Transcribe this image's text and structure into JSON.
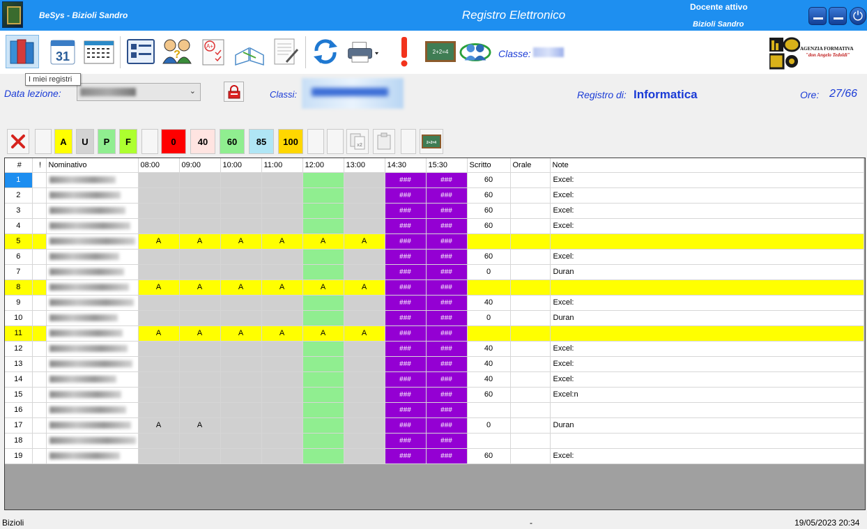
{
  "app": {
    "name": "BeSys - Bizioli Sandro",
    "title": "Registro Elettronico",
    "docente_label": "Docente attivo",
    "docente_name": "Bizioli Sandro"
  },
  "toolbar": {
    "classe_label": "Classe:",
    "tooltip": "I miei registri",
    "agency_line1": "AGENZIA FORMATIVA",
    "agency_line2": "\"don Angelo Tedoldi\""
  },
  "info": {
    "data_lezione_label": "Data lezione:",
    "classi_label": "Classi:",
    "registro_label": "Registro di:",
    "registro_value": "Informatica",
    "ore_label": "Ore:",
    "ore_value": "27/66"
  },
  "quick": {
    "a": "A",
    "u": "U",
    "p": "P",
    "f": "F",
    "v0": "0",
    "v40": "40",
    "v60": "60",
    "v85": "85",
    "v100": "100"
  },
  "colors": {
    "title_bar": "#1e8ff0",
    "label_blue": "#1a3bd6",
    "absent_row": "#ffff00",
    "purple_cell": "#9400d3",
    "green_cell": "#90ee90"
  },
  "grid": {
    "columns": [
      "#",
      "!",
      "Nominativo",
      "08:00",
      "09:00",
      "10:00",
      "11:00",
      "12:00",
      "13:00",
      "14:30",
      "15:30",
      "Scritto",
      "Orale",
      "Note"
    ],
    "rows": [
      {
        "n": "1",
        "absent": false,
        "h": [
          "",
          "",
          "",
          "",
          "",
          "",
          "###",
          "###"
        ],
        "scritto": "60",
        "note": "Excel:"
      },
      {
        "n": "2",
        "absent": false,
        "h": [
          "",
          "",
          "",
          "",
          "",
          "",
          "###",
          "###"
        ],
        "scritto": "60",
        "note": "Excel:"
      },
      {
        "n": "3",
        "absent": false,
        "h": [
          "",
          "",
          "",
          "",
          "",
          "",
          "###",
          "###"
        ],
        "scritto": "60",
        "note": "Excel:"
      },
      {
        "n": "4",
        "absent": false,
        "h": [
          "",
          "",
          "",
          "",
          "",
          "",
          "###",
          "###"
        ],
        "scritto": "60",
        "note": "Excel:"
      },
      {
        "n": "5",
        "absent": true,
        "h": [
          "A",
          "A",
          "A",
          "A",
          "A",
          "A",
          "###",
          "###"
        ],
        "scritto": "",
        "note": ""
      },
      {
        "n": "6",
        "absent": false,
        "h": [
          "",
          "",
          "",
          "",
          "",
          "",
          "###",
          "###"
        ],
        "scritto": "60",
        "note": "Excel:"
      },
      {
        "n": "7",
        "absent": false,
        "h": [
          "",
          "",
          "",
          "",
          "",
          "",
          "###",
          "###"
        ],
        "scritto": "0",
        "note": "Duran"
      },
      {
        "n": "8",
        "absent": true,
        "h": [
          "A",
          "A",
          "A",
          "A",
          "A",
          "A",
          "###",
          "###"
        ],
        "scritto": "",
        "note": ""
      },
      {
        "n": "9",
        "absent": false,
        "h": [
          "",
          "",
          "",
          "",
          "",
          "",
          "###",
          "###"
        ],
        "scritto": "40",
        "note": "Excel:"
      },
      {
        "n": "10",
        "absent": false,
        "h": [
          "",
          "",
          "",
          "",
          "",
          "",
          "###",
          "###"
        ],
        "scritto": "0",
        "note": "Duran"
      },
      {
        "n": "11",
        "absent": true,
        "h": [
          "A",
          "A",
          "A",
          "A",
          "A",
          "A",
          "###",
          "###"
        ],
        "scritto": "",
        "note": ""
      },
      {
        "n": "12",
        "absent": false,
        "h": [
          "",
          "",
          "",
          "",
          "",
          "",
          "###",
          "###"
        ],
        "scritto": "40",
        "note": "Excel:"
      },
      {
        "n": "13",
        "absent": false,
        "h": [
          "",
          "",
          "",
          "",
          "",
          "",
          "###",
          "###"
        ],
        "scritto": "40",
        "note": "Excel:"
      },
      {
        "n": "14",
        "absent": false,
        "h": [
          "",
          "",
          "",
          "",
          "",
          "",
          "###",
          "###"
        ],
        "scritto": "40",
        "note": "Excel:"
      },
      {
        "n": "15",
        "absent": false,
        "h": [
          "",
          "",
          "",
          "",
          "",
          "",
          "###",
          "###"
        ],
        "scritto": "60",
        "note": "Excel:n"
      },
      {
        "n": "16",
        "absent": false,
        "h": [
          "",
          "",
          "",
          "",
          "",
          "",
          "###",
          "###"
        ],
        "scritto": "",
        "note": ""
      },
      {
        "n": "17",
        "absent": false,
        "h": [
          "A",
          "A",
          "",
          "",
          "",
          "",
          "###",
          "###"
        ],
        "scritto": "0",
        "note": "Duran"
      },
      {
        "n": "18",
        "absent": false,
        "h": [
          "",
          "",
          "",
          "",
          "",
          "",
          "###",
          "###"
        ],
        "scritto": "",
        "note": ""
      },
      {
        "n": "19",
        "absent": false,
        "h": [
          "",
          "",
          "",
          "",
          "",
          "",
          "###",
          "###"
        ],
        "scritto": "60",
        "note": "Excel:"
      }
    ]
  },
  "status": {
    "user": "Bizioli",
    "middle": "-",
    "datetime": "19/05/2023  20:34"
  }
}
